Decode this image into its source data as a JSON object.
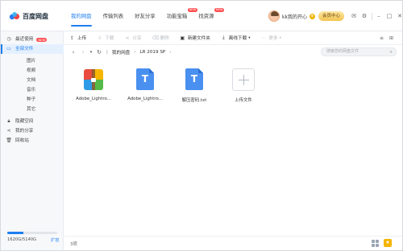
{
  "app": {
    "title": "百度网盘"
  },
  "nav": {
    "items": [
      {
        "label": "我的网盘",
        "active": true,
        "badge": ""
      },
      {
        "label": "传输列表",
        "active": false,
        "badge": ""
      },
      {
        "label": "好友分享",
        "active": false,
        "badge": ""
      },
      {
        "label": "功能宝箱",
        "active": false,
        "badge": "NEW"
      },
      {
        "label": "找资源",
        "active": false,
        "badge": "NEW"
      }
    ]
  },
  "user": {
    "name": "kk我的开心",
    "vip_button": "会员中心"
  },
  "window_icons": [
    "mail-icon",
    "gear-icon",
    "minimize-icon",
    "maximize-icon",
    "close-icon"
  ],
  "sidebar": {
    "items": [
      {
        "label": "最近使用",
        "icon": "clock-icon",
        "badge": "NEW",
        "sub": false,
        "active": false
      },
      {
        "label": "全部文件",
        "icon": "folder-icon",
        "badge": "",
        "sub": false,
        "active": true
      },
      {
        "label": "图片",
        "icon": "",
        "badge": "",
        "sub": true,
        "active": false
      },
      {
        "label": "视频",
        "icon": "",
        "badge": "",
        "sub": true,
        "active": false
      },
      {
        "label": "文档",
        "icon": "",
        "badge": "",
        "sub": true,
        "active": false
      },
      {
        "label": "音乐",
        "icon": "",
        "badge": "",
        "sub": true,
        "active": false
      },
      {
        "label": "种子",
        "icon": "",
        "badge": "",
        "sub": true,
        "active": false
      },
      {
        "label": "其它",
        "icon": "",
        "badge": "",
        "sub": true,
        "active": false
      },
      {
        "label": "隐藏空间",
        "icon": "lock-icon",
        "badge": "",
        "sub": false,
        "active": false
      },
      {
        "label": "我的分享",
        "icon": "share-icon",
        "badge": "",
        "sub": false,
        "active": false
      },
      {
        "label": "回收站",
        "icon": "trash-icon",
        "badge": "",
        "sub": false,
        "active": false
      }
    ],
    "quota": {
      "text": "1620G/5140G",
      "expand_label": "扩容",
      "used_fraction": 0.315
    }
  },
  "toolbar": {
    "buttons": [
      {
        "label": "上传",
        "icon": "upload-icon",
        "disabled": false
      },
      {
        "label": "下载",
        "icon": "download-icon",
        "disabled": true
      },
      {
        "label": "分享",
        "icon": "share-icon",
        "disabled": true
      },
      {
        "label": "删除",
        "icon": "delete-icon",
        "disabled": true
      },
      {
        "label": "新建文件夹",
        "icon": "new-folder-icon",
        "disabled": false
      },
      {
        "label": "离线下载",
        "icon": "offline-download-icon",
        "disabled": false
      },
      {
        "label": "更多",
        "icon": "more-icon",
        "disabled": true
      }
    ]
  },
  "address": {
    "crumbs": [
      "我的网盘",
      "LR 2019 SP"
    ],
    "search_placeholder": "搜索您的网盘文件"
  },
  "files": [
    {
      "name": "Adobe_Lightro...",
      "type": "zip"
    },
    {
      "name": "Adobe_Lightro...",
      "type": "doc"
    },
    {
      "name": "解压密码.txt",
      "type": "doc"
    },
    {
      "name": "上传文件",
      "type": "upload"
    }
  ],
  "status": {
    "count": "3项"
  },
  "colors": {
    "accent": "#1f7ff0",
    "badge": "#ff4d4f",
    "vip": "#f3c450"
  }
}
